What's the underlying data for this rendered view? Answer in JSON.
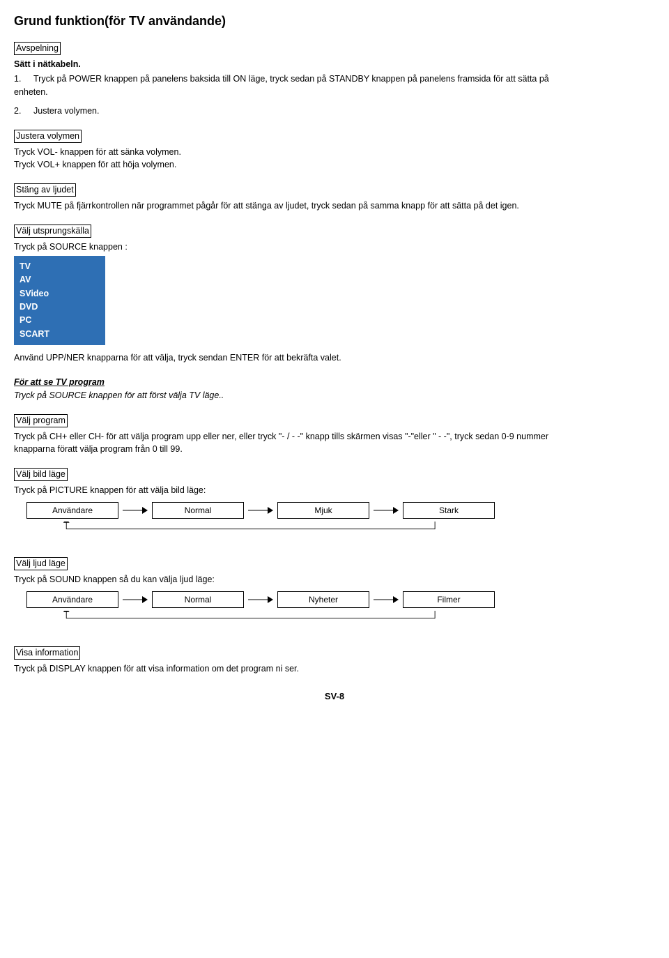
{
  "title": "Grund funktion(för TV användande)",
  "avspelning": {
    "heading": "Avspelning",
    "sub": "Sätt i nätkabeln.",
    "item1_num": "1.",
    "item1_text": "Tryck på POWER knappen på panelens baksida till ON läge, tryck sedan på STANDBY knappen på panelens framsida för att sätta på",
    "item1_text2": "enheten.",
    "item2_num": "2.",
    "item2_text": "Justera volymen."
  },
  "justera": {
    "heading": "Justera volymen",
    "l1": "Tryck VOL- knappen för att sänka volymen.",
    "l2": "Tryck VOL+ knappen för att höja volymen."
  },
  "stang": {
    "heading": "Stäng av ljudet",
    "l1": "Tryck MUTE på fjärrkontrollen när programmet pågår för att stänga av ljudet, tryck sedan på samma knapp för att sätta på det igen."
  },
  "utsprung": {
    "heading": "Välj utsprungskälla",
    "l1": "Tryck på SOURCE knappen :",
    "sources": [
      "TV",
      "AV",
      "SVideo",
      "DVD",
      "PC",
      "SCART"
    ],
    "l2": "Använd UPP/NER knapparna för att välja, tryck sendan ENTER för att bekräfta valet."
  },
  "tvprog": {
    "heading": "För att se TV program",
    "l1": "Tryck på SOURCE knappen för att först välja TV läge.."
  },
  "valjprog": {
    "heading": "Välj program",
    "l1": "Tryck på CH+ eller CH- för att välja program upp eller ner, eller tryck \"- / - -\" knapp tills skärmen visas \"-\"eller \" - -\",   tryck sedan 0-9 nummer",
    "l2": "knapparna föratt välja program från 0 till 99."
  },
  "bild": {
    "heading": "Välj bild läge",
    "l1": "Tryck på PICTURE knappen för att välja bild läge:",
    "boxes": [
      "Användare",
      "Normal",
      "Mjuk",
      "Stark"
    ]
  },
  "ljud": {
    "heading": "Välj ljud läge",
    "l1": "Tryck på SOUND knappen så du kan välja ljud läge:",
    "boxes": [
      "Användare",
      "Normal",
      "Nyheter",
      "Filmer"
    ]
  },
  "info": {
    "heading": "Visa information",
    "l1": "Tryck på DISPLAY knappen för att visa information om det program ni ser."
  },
  "footer": "SV-8"
}
